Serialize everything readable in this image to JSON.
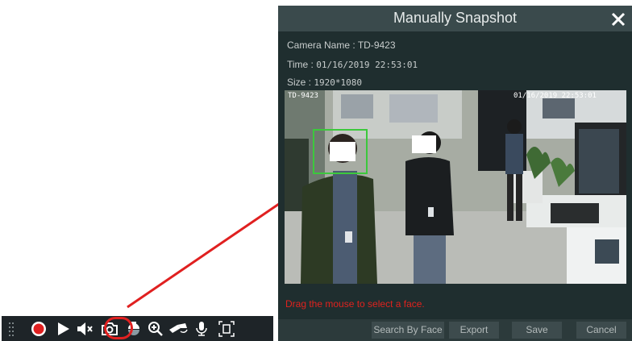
{
  "dialog": {
    "title": "Manually Snapshot",
    "camera_name_label": "Camera Name :",
    "camera_name": "TD-9423",
    "time_label": "Time :",
    "time": "01/16/2019 22:53:01",
    "size_label": "Size :",
    "size": "1920*1080",
    "overlay_camera": "TD-9423",
    "overlay_time": "01/16/2019 22:53:01",
    "hint": "Drag the mouse to select a face.",
    "buttons": {
      "search_by_face": "Search By Face",
      "export": "Export",
      "save": "Save",
      "cancel": "Cancel"
    }
  },
  "toolbar": {
    "icons": [
      "grip-icon",
      "record-icon",
      "play-icon",
      "mute-icon",
      "snapshot-icon",
      "ptz-icon",
      "zoom-icon",
      "rotate-icon",
      "talk-icon",
      "face-detect-icon"
    ],
    "highlighted": "snapshot-icon"
  },
  "colors": {
    "accent_red": "#e0221e",
    "toolbar_bg": "#1e2428",
    "dialog_bg": "#1f2e2f",
    "face_box": "#3cc83c"
  }
}
